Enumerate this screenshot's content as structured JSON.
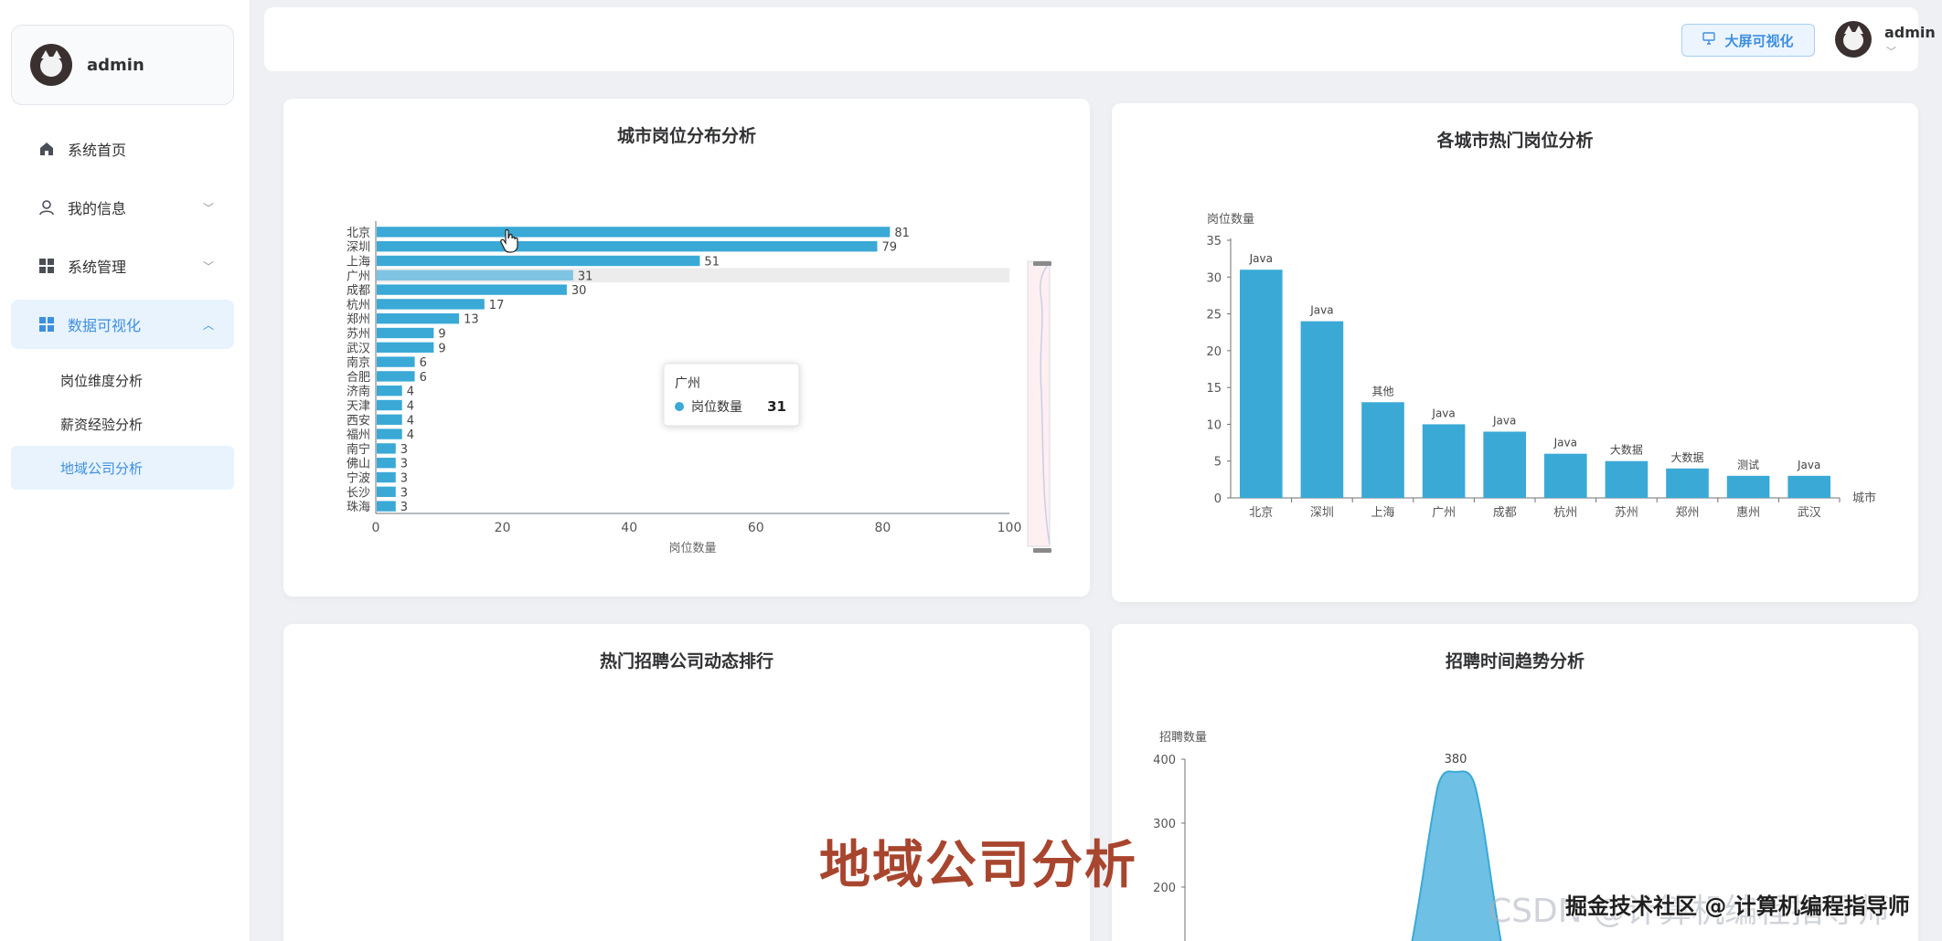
{
  "sidebar": {
    "username": "admin",
    "menu": [
      {
        "label": "系统首页",
        "icon": "home-icon",
        "has_children": false
      },
      {
        "label": "我的信息",
        "icon": "user-icon",
        "has_children": true
      },
      {
        "label": "系统管理",
        "icon": "grid-icon",
        "has_children": true
      },
      {
        "label": "数据可视化",
        "icon": "grid-icon",
        "has_children": true,
        "expanded": true
      }
    ],
    "submenu": [
      {
        "label": "岗位维度分析"
      },
      {
        "label": "薪资经验分析"
      },
      {
        "label": "地域公司分析",
        "active": true
      }
    ]
  },
  "header": {
    "big_screen_label": "大屏可视化",
    "username": "admin"
  },
  "accent_color": "#3d8fe0",
  "bar_color": "#3aa9d6",
  "chart_data": [
    {
      "id": "city-distribution",
      "type": "bar",
      "orientation": "horizontal",
      "title": "城市岗位分布分析",
      "xlabel": "岗位数量",
      "xlim": [
        0,
        100
      ],
      "xticks": [
        0,
        20,
        40,
        60,
        80,
        100
      ],
      "categories": [
        "北京",
        "深圳",
        "上海",
        "广州",
        "成都",
        "杭州",
        "郑州",
        "苏州",
        "武汉",
        "南京",
        "合肥",
        "济南",
        "天津",
        "西安",
        "福州",
        "南宁",
        "佛山",
        "宁波",
        "长沙",
        "珠海"
      ],
      "values": [
        81,
        79,
        51,
        31,
        30,
        17,
        13,
        9,
        9,
        6,
        6,
        4,
        4,
        4,
        4,
        3,
        3,
        3,
        3,
        3
      ],
      "highlighted": "广州",
      "tooltip": {
        "title": "广州",
        "series_name": "岗位数量",
        "value": 31
      }
    },
    {
      "id": "city-hot-jobs",
      "type": "bar",
      "title": "各城市热门岗位分析",
      "ylabel": "岗位数量",
      "xlabel": "城市",
      "ylim": [
        0,
        35
      ],
      "yticks": [
        0,
        5,
        10,
        15,
        20,
        25,
        30,
        35
      ],
      "categories": [
        "北京",
        "深圳",
        "上海",
        "广州",
        "成都",
        "杭州",
        "苏州",
        "郑州",
        "惠州",
        "武汉"
      ],
      "values": [
        31,
        24,
        13,
        10,
        9,
        6,
        5,
        4,
        3,
        3
      ],
      "labels": [
        "Java",
        "Java",
        "其他",
        "Java",
        "Java",
        "Java",
        "大数据",
        "大数据",
        "测试",
        "Java"
      ]
    },
    {
      "id": "company-ranking",
      "type": "bar",
      "title": "热门招聘公司动态排行"
    },
    {
      "id": "time-trend",
      "type": "area",
      "title": "招聘时间趋势分析",
      "ylabel": "招聘数量",
      "yticks_visible": [
        400,
        300,
        200
      ],
      "peak_value": 380
    }
  ],
  "overlay": {
    "caption": "地域公司分析",
    "watermark_csdn": "CSDN @计算机编程指导师",
    "watermark_juejin": "掘金技术社区 @ 计算机编程指导师"
  }
}
